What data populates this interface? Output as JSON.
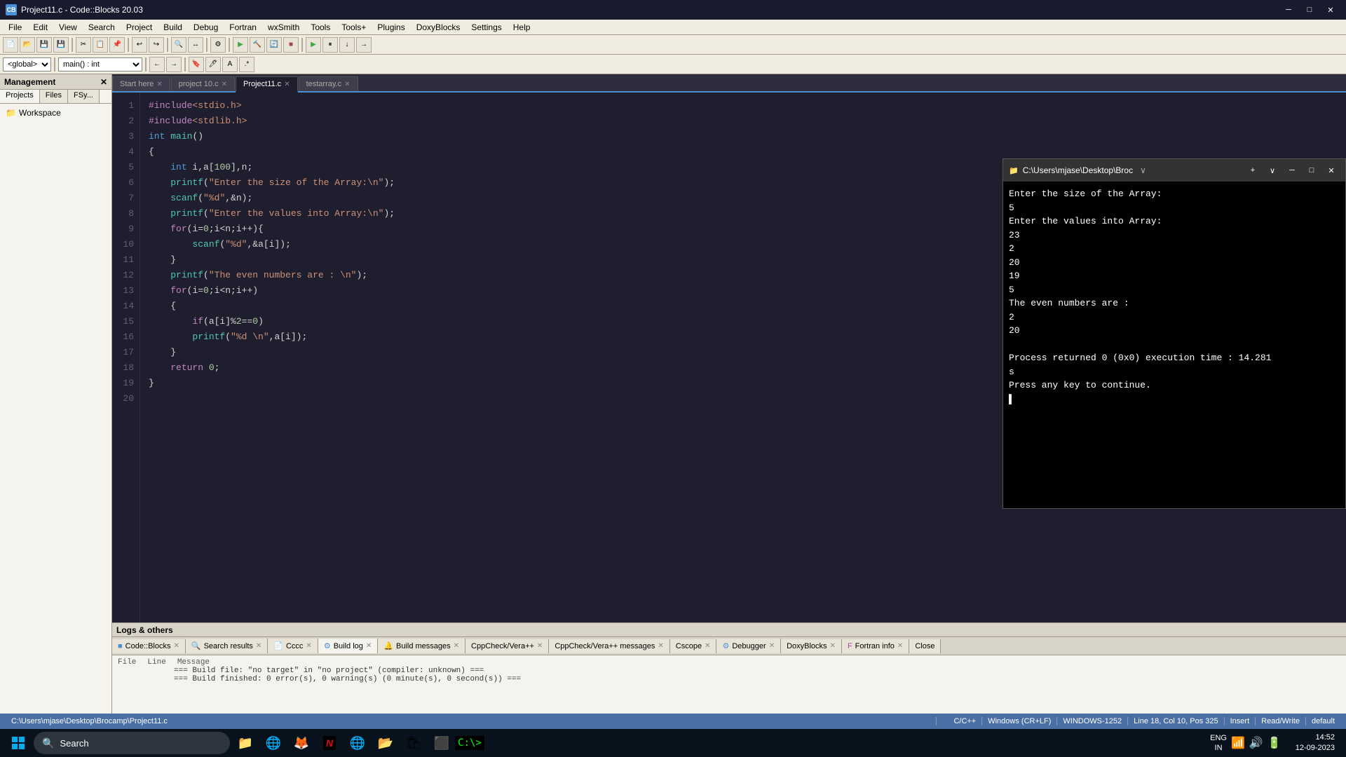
{
  "app": {
    "title": "Project11.c - Code::Blocks 20.03",
    "icon_label": "CB"
  },
  "menu": {
    "items": [
      "File",
      "Edit",
      "View",
      "Search",
      "Project",
      "Build",
      "Debug",
      "Fortran",
      "wxSmith",
      "Tools",
      "Tools+",
      "Plugins",
      "DoxyBlocks",
      "Settings",
      "Help"
    ]
  },
  "toolbar": {
    "global_combo": "<global>",
    "main_combo": "main() : int"
  },
  "tabs": {
    "items": [
      {
        "label": "Start here",
        "active": false,
        "closable": true
      },
      {
        "label": "project 10.c",
        "active": false,
        "closable": true
      },
      {
        "label": "Project11.c",
        "active": true,
        "closable": true
      },
      {
        "label": "testarray.c",
        "active": false,
        "closable": true
      }
    ]
  },
  "code": {
    "lines": [
      {
        "num": 1,
        "content": "#include<stdio.h>"
      },
      {
        "num": 2,
        "content": "#include<stdlib.h>"
      },
      {
        "num": 3,
        "content": "int main()"
      },
      {
        "num": 4,
        "content": "{"
      },
      {
        "num": 5,
        "content": "    int i,a[100],n;"
      },
      {
        "num": 6,
        "content": "    printf(\"Enter the size of the Array:\\n\");"
      },
      {
        "num": 7,
        "content": "    scanf(\"%d\",&n);"
      },
      {
        "num": 8,
        "content": "    printf(\"Enter the values into Array:\\n\");"
      },
      {
        "num": 9,
        "content": "    for(i=0;i<n;i++){"
      },
      {
        "num": 10,
        "content": "        scanf(\"%d\",&a[i]);"
      },
      {
        "num": 11,
        "content": "    }"
      },
      {
        "num": 12,
        "content": "    printf(\"The even numbers are : \\n\");"
      },
      {
        "num": 13,
        "content": "    for(i=0;i<n;i++)"
      },
      {
        "num": 14,
        "content": "    {"
      },
      {
        "num": 15,
        "content": "        if(a[i]%2==0)"
      },
      {
        "num": 16,
        "content": "        printf(\"%d \\n\",a[i]);"
      },
      {
        "num": 17,
        "content": "    }"
      },
      {
        "num": 18,
        "content": "    return 0;"
      },
      {
        "num": 19,
        "content": "}"
      },
      {
        "num": 20,
        "content": ""
      }
    ]
  },
  "left_panel": {
    "title": "Management",
    "tabs": [
      "Projects",
      "Files",
      "FSy..."
    ],
    "tree": [
      {
        "label": "Workspace",
        "icon": "folder"
      }
    ]
  },
  "bottom_panel": {
    "title": "Logs & others",
    "tabs": [
      "Code::Blocks",
      "Search results",
      "Cccc",
      "Build log",
      "Build messages",
      "CppCheck/Vera++",
      "CppCheck/Vera++ messages",
      "Cscope",
      "Debugger",
      "DoxyBlocks",
      "Fortran info",
      "Close"
    ],
    "active_tab": "Build log",
    "columns": [
      "File",
      "Line",
      "Message"
    ],
    "log_lines": [
      "=== Build file: \"no target\" in \"no project\" (compiler: unknown) ===",
      "=== Build finished: 0 error(s), 0 warning(s) (0 minute(s), 0 second(s)) ==="
    ]
  },
  "terminal": {
    "title": "C:\\Users\\mjase\\Desktop\\Broc",
    "output": [
      "Enter the size of the Array:",
      "5",
      "Enter the values into Array:",
      "23",
      "2",
      "20",
      "19",
      "5",
      "The even numbers are :",
      "2",
      "20",
      "",
      "Process returned 0 (0x0)   execution time : 14.281",
      "s",
      "Press any key to continue."
    ]
  },
  "status_bar": {
    "path": "C:\\Users\\mjase\\Desktop\\Brocamp\\Project11.c",
    "language": "C/C++",
    "line_ending": "Windows (CR+LF)",
    "encoding": "WINDOWS-1252",
    "position": "Line 18, Col 10, Pos 325",
    "mode": "Insert",
    "access": "Read/Write",
    "extra": "default"
  },
  "taskbar": {
    "search_placeholder": "Search",
    "time": "14:52",
    "date": "12-09-2023",
    "lang": "ENG\nIN"
  },
  "icons": {
    "start": "⊞",
    "search": "🔍",
    "terminal": "📁",
    "edge": "🌐",
    "firefox": "🦊",
    "netflix": "N",
    "chrome": "●",
    "files": "📂",
    "store": "🛍",
    "apps": "⬛",
    "cmd": ">_"
  }
}
